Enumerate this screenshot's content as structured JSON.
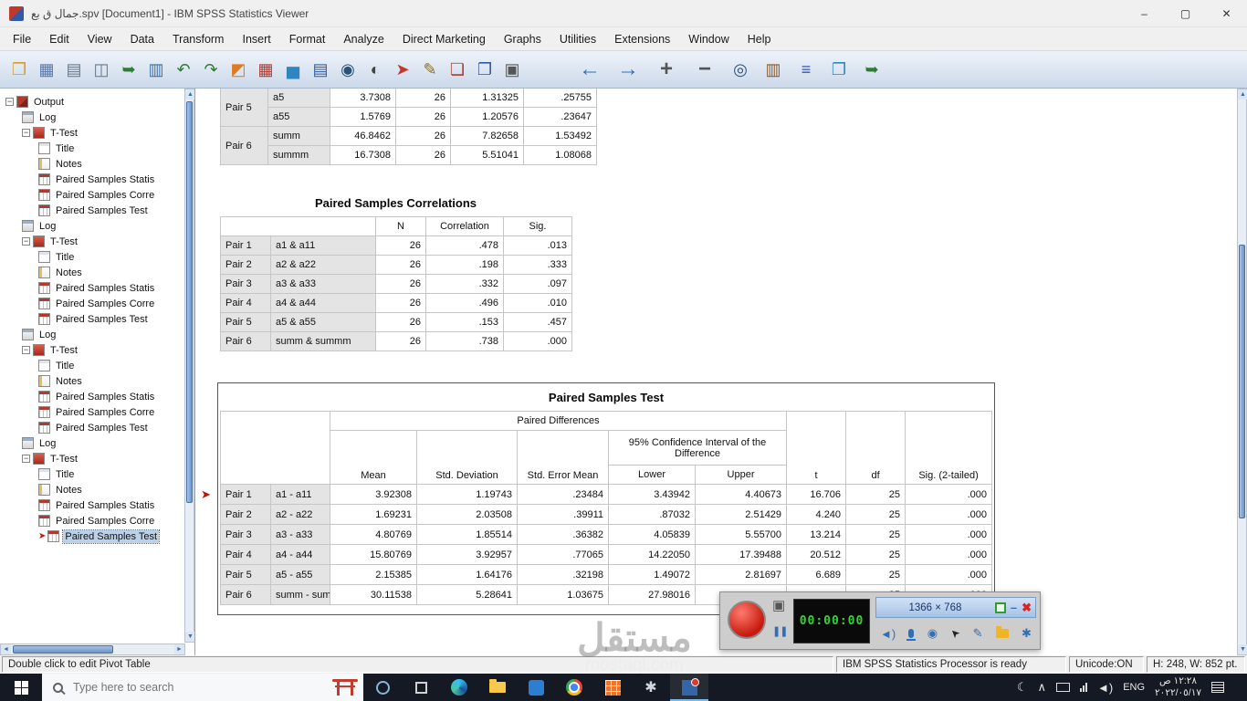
{
  "window": {
    "title": "جمال ق بع.spv [Document1] - IBM SPSS Statistics Viewer",
    "controls": {
      "minimize": "–",
      "maximize": "▢",
      "close": "✕"
    }
  },
  "menu": {
    "items": [
      "File",
      "Edit",
      "View",
      "Data",
      "Transform",
      "Insert",
      "Format",
      "Analyze",
      "Direct Marketing",
      "Graphs",
      "Utilities",
      "Extensions",
      "Window",
      "Help"
    ]
  },
  "toolbar": {
    "left": [
      {
        "n": "open-file-icon",
        "g": "❒",
        "c": "#d99a2b"
      },
      {
        "n": "save-icon",
        "g": "▦",
        "c": "#5577aa"
      },
      {
        "n": "print-icon",
        "g": "▤",
        "c": "#667788"
      },
      {
        "n": "print-preview-icon",
        "g": "◫",
        "c": "#667788"
      },
      {
        "n": "export-output-icon",
        "g": "➥",
        "c": "#2f7d32"
      },
      {
        "n": "recall-dialogs-icon",
        "g": "▥",
        "c": "#3b6ea5"
      },
      {
        "n": "undo-icon",
        "g": "↶",
        "c": "#2f7d32"
      },
      {
        "n": "redo-icon",
        "g": "↷",
        "c": "#2f7d32"
      },
      {
        "n": "goto-chart-icon",
        "g": "◩",
        "c": "#e07a20"
      },
      {
        "n": "goto-data-icon",
        "g": "▦",
        "c": "#b03a2e"
      },
      {
        "n": "insert-chart-icon",
        "g": "▅",
        "c": "#2e86c1"
      },
      {
        "n": "variables-icon",
        "g": "▤",
        "c": "#2e5aa8"
      },
      {
        "n": "find-icon",
        "g": "◉",
        "c": "#28537a"
      },
      {
        "n": "use-sets-icon",
        "g": "◐",
        "c": "#444444"
      },
      {
        "n": "select-last-output-icon",
        "g": "➤",
        "c": "#c0392b"
      },
      {
        "n": "designate-window-icon",
        "g": "✎",
        "c": "#8a6d1d"
      },
      {
        "n": "insert-heading-icon",
        "g": "❏",
        "c": "#b03a2e"
      },
      {
        "n": "insert-title-icon",
        "g": "❐",
        "c": "#2e5aa8"
      },
      {
        "n": "screenshot-icon",
        "g": "▣",
        "c": "#555555"
      }
    ],
    "right": [
      {
        "n": "back-icon",
        "g": "←",
        "c": "#2f6fb8"
      },
      {
        "n": "forward-icon",
        "g": "→",
        "c": "#2f6fb8"
      },
      {
        "n": "promote-icon",
        "g": "+",
        "c": "#555555"
      },
      {
        "n": "demote-icon",
        "g": "−",
        "c": "#555555"
      },
      {
        "n": "zoom-icon",
        "g": "◎",
        "c": "#28537a"
      },
      {
        "n": "glossary-icon",
        "g": "▥",
        "c": "#8b5a2b"
      },
      {
        "n": "outline-icon",
        "g": "≡",
        "c": "#2e5aa8"
      },
      {
        "n": "new-document-icon",
        "g": "❐",
        "c": "#2e86c1"
      },
      {
        "n": "export-icon",
        "g": "➥",
        "c": "#2f7d32"
      }
    ]
  },
  "sidebar": {
    "items": [
      {
        "d": 0,
        "t": "book",
        "l": "Output",
        "e": true
      },
      {
        "d": 1,
        "t": "log",
        "l": "Log"
      },
      {
        "d": 1,
        "t": "ttest",
        "l": "T-Test",
        "e": true
      },
      {
        "d": 2,
        "t": "title",
        "l": "Title"
      },
      {
        "d": 2,
        "t": "notes",
        "l": "Notes"
      },
      {
        "d": 2,
        "t": "table",
        "l": "Paired Samples Statis"
      },
      {
        "d": 2,
        "t": "table",
        "l": "Paired Samples Corre"
      },
      {
        "d": 2,
        "t": "table",
        "l": "Paired Samples Test"
      },
      {
        "d": 1,
        "t": "log",
        "l": "Log"
      },
      {
        "d": 1,
        "t": "ttest",
        "l": "T-Test",
        "e": true
      },
      {
        "d": 2,
        "t": "title",
        "l": "Title"
      },
      {
        "d": 2,
        "t": "notes",
        "l": "Notes"
      },
      {
        "d": 2,
        "t": "table",
        "l": "Paired Samples Statis"
      },
      {
        "d": 2,
        "t": "table",
        "l": "Paired Samples Corre"
      },
      {
        "d": 2,
        "t": "table",
        "l": "Paired Samples Test"
      },
      {
        "d": 1,
        "t": "log",
        "l": "Log"
      },
      {
        "d": 1,
        "t": "ttest",
        "l": "T-Test",
        "e": true
      },
      {
        "d": 2,
        "t": "title",
        "l": "Title"
      },
      {
        "d": 2,
        "t": "notes",
        "l": "Notes"
      },
      {
        "d": 2,
        "t": "table",
        "l": "Paired Samples Statis"
      },
      {
        "d": 2,
        "t": "table",
        "l": "Paired Samples Corre"
      },
      {
        "d": 2,
        "t": "table",
        "l": "Paired Samples Test"
      },
      {
        "d": 1,
        "t": "log",
        "l": "Log"
      },
      {
        "d": 1,
        "t": "ttest",
        "l": "T-Test",
        "e": true
      },
      {
        "d": 2,
        "t": "title",
        "l": "Title"
      },
      {
        "d": 2,
        "t": "notes",
        "l": "Notes"
      },
      {
        "d": 2,
        "t": "table",
        "l": "Paired Samples Statis"
      },
      {
        "d": 2,
        "t": "table",
        "l": "Paired Samples Corre"
      },
      {
        "d": 2,
        "t": "table",
        "l": "Paired Samples Test",
        "sel": true
      }
    ]
  },
  "tables": {
    "statistics_partial": {
      "rows": [
        [
          "Pair 5",
          "a5",
          "3.7308",
          "26",
          "1.31325",
          ".25755"
        ],
        [
          "",
          "a55",
          "1.5769",
          "26",
          "1.20576",
          ".23647"
        ],
        [
          "Pair 6",
          "summ",
          "46.8462",
          "26",
          "7.82658",
          "1.53492"
        ],
        [
          "",
          "summm",
          "16.7308",
          "26",
          "5.51041",
          "1.08068"
        ]
      ]
    },
    "correlations": {
      "title": "Paired Samples Correlations",
      "headers": [
        "N",
        "Correlation",
        "Sig."
      ],
      "rows": [
        [
          "Pair 1",
          "a1 & a11",
          "26",
          ".478",
          ".013"
        ],
        [
          "Pair 2",
          "a2 & a22",
          "26",
          ".198",
          ".333"
        ],
        [
          "Pair 3",
          "a3 & a33",
          "26",
          ".332",
          ".097"
        ],
        [
          "Pair 4",
          "a4 & a44",
          "26",
          ".496",
          ".010"
        ],
        [
          "Pair 5",
          "a5 & a55",
          "26",
          ".153",
          ".457"
        ],
        [
          "Pair 6",
          "summ & summm",
          "26",
          ".738",
          ".000"
        ]
      ]
    },
    "test": {
      "title": "Paired Samples Test",
      "group_header": "Paired Differences",
      "ci_header": "95% Confidence Interval of the Difference",
      "columns": [
        "Mean",
        "Std. Deviation",
        "Std. Error Mean",
        "Lower",
        "Upper",
        "t",
        "df",
        "Sig. (2-tailed)"
      ],
      "rows": [
        [
          "Pair 1",
          "a1 - a11",
          "3.92308",
          "1.19743",
          ".23484",
          "3.43942",
          "4.40673",
          "16.706",
          "25",
          ".000"
        ],
        [
          "Pair 2",
          "a2 - a22",
          "1.69231",
          "2.03508",
          ".39911",
          ".87032",
          "2.51429",
          "4.240",
          "25",
          ".000"
        ],
        [
          "Pair 3",
          "a3 - a33",
          "4.80769",
          "1.85514",
          ".36382",
          "4.05839",
          "5.55700",
          "13.214",
          "25",
          ".000"
        ],
        [
          "Pair 4",
          "a4 - a44",
          "15.80769",
          "3.92957",
          ".77065",
          "14.22050",
          "17.39488",
          "20.512",
          "25",
          ".000"
        ],
        [
          "Pair 5",
          "a5 - a55",
          "2.15385",
          "1.64176",
          ".32198",
          "1.49072",
          "2.81697",
          "6.689",
          "25",
          ".000"
        ],
        [
          "Pair 6",
          "summ - summm",
          "30.11538",
          "5.28641",
          "1.03675",
          "27.98016",
          "",
          "",
          "25",
          ".000"
        ]
      ]
    }
  },
  "statusbar": {
    "hint": "Double click to edit Pivot Table",
    "processor": "IBM SPSS Statistics Processor is ready",
    "unicode": "Unicode:ON",
    "size": "H: 248, W: 852 pt."
  },
  "recorder": {
    "timer": "00:00:00",
    "resolution": "1366 × 768"
  },
  "taskbar": {
    "search_placeholder": "Type here to search",
    "language": "ENG",
    "time": "١٢:٢٨ ص",
    "date": "٢٠٢٢/٠٥/١٧",
    "apps": [
      {
        "n": "cortana-icon",
        "cls": "ic-cortana"
      },
      {
        "n": "task-view-icon",
        "cls": "ic-taskview"
      },
      {
        "n": "edge-icon",
        "cls": "ic-edge"
      },
      {
        "n": "file-explorer-icon",
        "cls": "ic-folder"
      },
      {
        "n": "store-icon",
        "cls": "ic-store"
      },
      {
        "n": "chrome-icon",
        "cls": "ic-chrome"
      },
      {
        "n": "spss-data-icon",
        "cls": "ic-spssdata"
      },
      {
        "n": "settings-icon",
        "g": "✱"
      },
      {
        "n": "spss-viewer-icon",
        "cls": "ic-spssview",
        "active": true
      }
    ]
  },
  "watermark": {
    "line1": "مستقل",
    "line2": "mostaql.com"
  }
}
